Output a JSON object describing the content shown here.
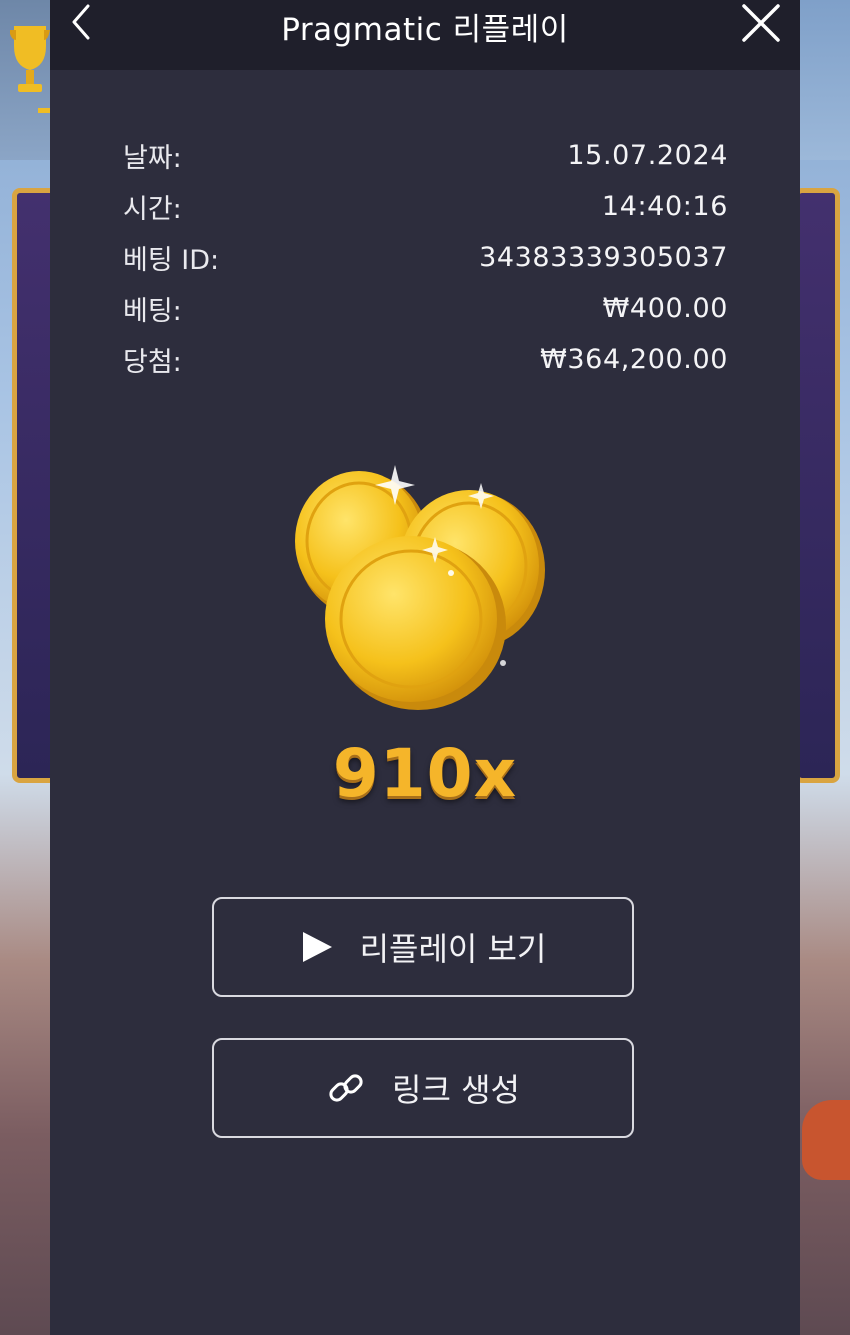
{
  "header": {
    "title": "Pragmatic 리플레이",
    "back_icon": "chevron-left-icon",
    "close_icon": "close-icon"
  },
  "details": [
    {
      "label": "날짜:",
      "value": "15.07.2024"
    },
    {
      "label": "시간:",
      "value": "14:40:16"
    },
    {
      "label": "베팅 ID:",
      "value": "34383339305037"
    },
    {
      "label": "베팅:",
      "value": "₩400.00"
    },
    {
      "label": "당첨:",
      "value": "₩364,200.00"
    }
  ],
  "result": {
    "multiplier": "910x",
    "image_icon": "gold-coins-icon"
  },
  "buttons": {
    "replay_label": "리플레이 보기",
    "replay_icon": "play-icon",
    "link_label": "링크 생성",
    "link_icon": "link-icon"
  },
  "colors": {
    "modal_bg": "#2d2d3d",
    "header_bg": "#1f1f2b",
    "multiplier": "#f5b52a",
    "coin_gold": "#f2c21f"
  }
}
